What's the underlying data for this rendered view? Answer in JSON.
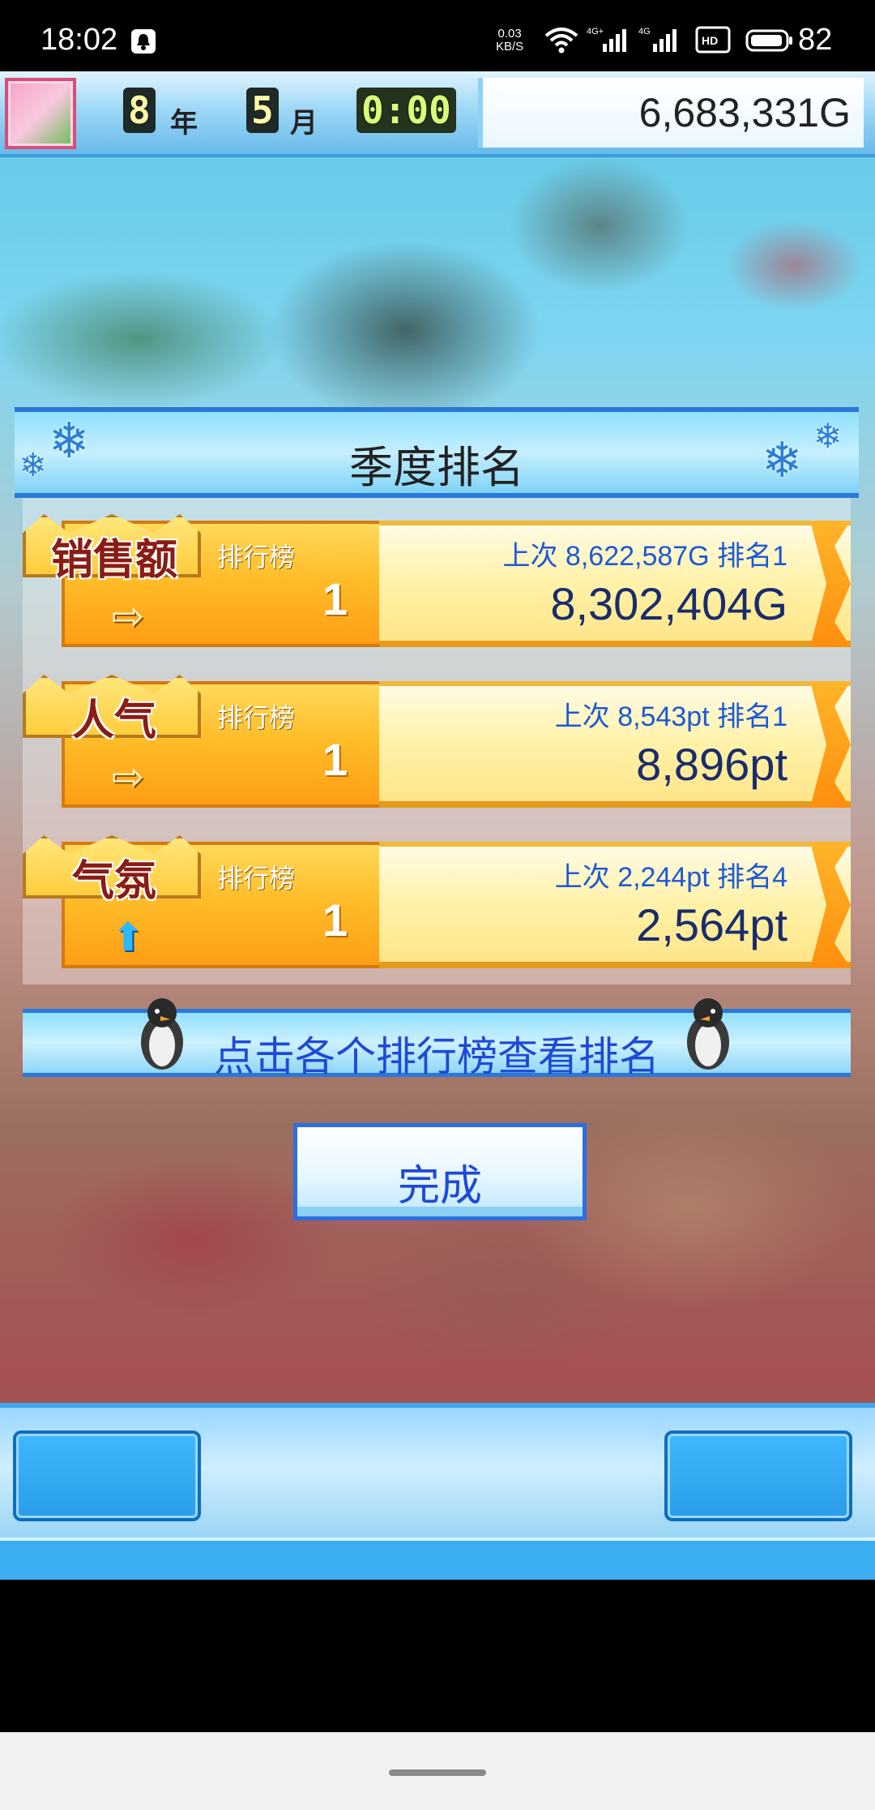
{
  "status_bar": {
    "time": "18:02",
    "speed": "0.03\nKB/S",
    "network": "4G",
    "battery": "82"
  },
  "hud": {
    "year_value": "8",
    "year_unit": "年",
    "month_value": "5",
    "month_unit": "月",
    "time": "0:00",
    "money": "6,683,331G"
  },
  "dialog": {
    "title": "季度排名",
    "board_label": "排行榜",
    "rows": [
      {
        "category": "销售额",
        "rank": "1",
        "trend": "right-arrow-icon",
        "previous": "上次 8,622,587G 排名1",
        "value": "8,302,404G"
      },
      {
        "category": "人气",
        "rank": "1",
        "trend": "right-arrow-icon",
        "previous": "上次 8,543pt 排名1",
        "value": "8,896pt"
      },
      {
        "category": "气氛",
        "rank": "1",
        "trend": "up-arrow-icon",
        "previous": "上次 2,244pt 排名4",
        "value": "2,564pt"
      }
    ],
    "hint": "点击各个排行榜查看排名",
    "done_label": "完成"
  },
  "colors": {
    "accent_blue": "#2a79d8",
    "rank_orange": "#ffbd2a",
    "value_text": "#1a2c6c"
  }
}
